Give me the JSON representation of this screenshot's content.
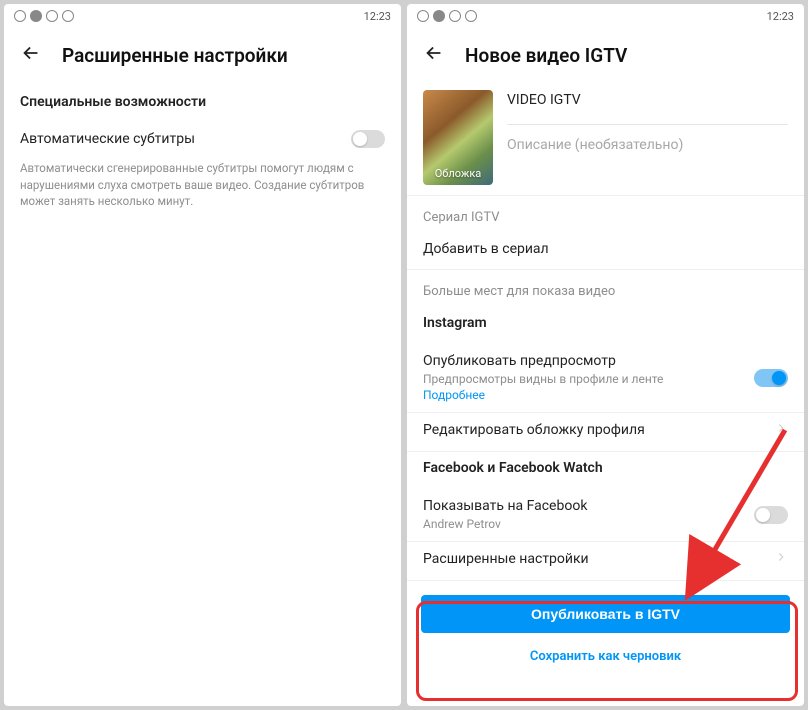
{
  "statusbar": {
    "time": "12:23"
  },
  "left": {
    "title": "Расширенные настройки",
    "section": "Специальные возможности",
    "subtitles_label": "Автоматические субтитры",
    "hint": "Автоматически сгенерированные субтитры помогут людям с нарушениями слуха смотреть ваше видео. Создание субтитров может занять несколько минут."
  },
  "right": {
    "title": "Новое видео IGTV",
    "thumb_label": "Обложка",
    "video_title": "VIDEO IGTV",
    "desc_placeholder": "Описание (необязательно)",
    "series_label": "Сериал IGTV",
    "add_to_series": "Добавить в сериал",
    "more_places": "Больше мест для показа видео",
    "instagram": "Instagram",
    "preview_title": "Опубликовать предпросмотр",
    "preview_sub": "Предпросмотры видны в профиле и ленте",
    "preview_link": "Подробнее",
    "edit_cover": "Редактировать обложку профиля",
    "facebook": "Facebook и Facebook Watch",
    "show_on_fb": "Показывать на Facebook",
    "fb_sub": "Andrew Petrov",
    "advanced": "Расширенные настройки",
    "publish_btn": "Опубликовать в IGTV",
    "save_draft": "Сохранить как черновик"
  }
}
